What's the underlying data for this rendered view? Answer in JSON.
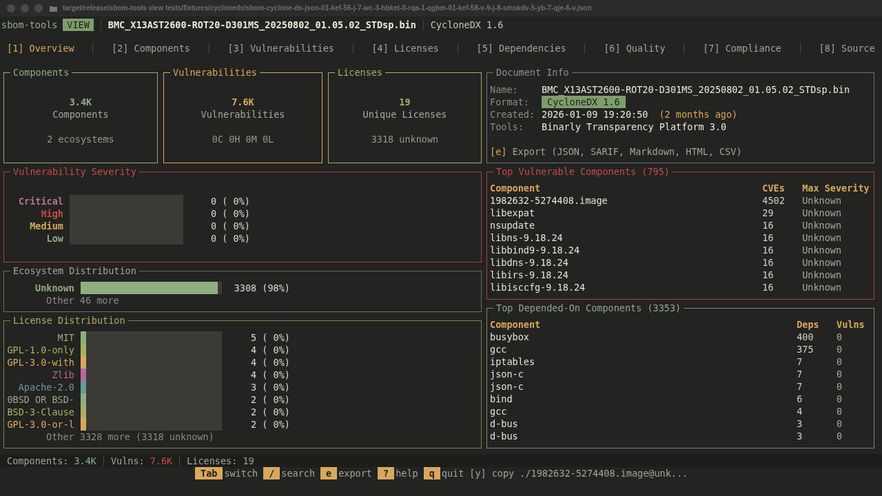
{
  "window": {
    "title": "target/release/sbom-tools view tests/fixtures/cyclonedx/sbom-cyclone-dx-json-01-kef-56-j-7-wc-3-hbket-0-rqa-1-qgbm-01-kef-58-v-9-j-8-smskdv-5-yb-7-qje-6-v.json"
  },
  "header": {
    "app": "sbom-tools",
    "mode": "VIEW",
    "file": "BMC_X13AST2600-ROT20-D301MS_20250802_01.05.02_STDsp.bin",
    "format": "CycloneDX 1.6"
  },
  "tabs": [
    {
      "label": "[1] Overview",
      "selected": true
    },
    {
      "label": "[2] Components",
      "selected": false
    },
    {
      "label": "[3] Vulnerabilities",
      "selected": false
    },
    {
      "label": "[4] Licenses",
      "selected": false
    },
    {
      "label": "[5] Dependencies",
      "selected": false
    },
    {
      "label": "[6] Quality",
      "selected": false
    },
    {
      "label": "[7] Compliance",
      "selected": false
    },
    {
      "label": "[8] Source",
      "selected": false
    }
  ],
  "stat_cards": [
    {
      "title": "Components",
      "value": "3.4K",
      "label": "Components",
      "detail": "2 ecosystems",
      "color": "#8fae80"
    },
    {
      "title": "Vulnerabilities",
      "value": "7.6K",
      "label": "Vulnerabilities",
      "detail": "0C 0H 0M 0L",
      "color": "#d9a85c"
    },
    {
      "title": "Licenses",
      "value": "19",
      "label": "Unique Licenses",
      "detail": "3318 unknown",
      "color": "#a9b064"
    }
  ],
  "severity": {
    "title": "Vulnerability Severity",
    "rows": [
      {
        "label": "Critical",
        "color": "#b87592",
        "reading": "0 ( 0%)"
      },
      {
        "label": "High",
        "color": "#c94a4a",
        "reading": "0 ( 0%)"
      },
      {
        "label": "Medium",
        "color": "#d9a85c",
        "reading": "0 ( 0%)"
      },
      {
        "label": "Low",
        "color": "#8fae80",
        "reading": "0 ( 0%)"
      }
    ]
  },
  "ecosystems": {
    "title": "Ecosystem Distribution",
    "rows": [
      {
        "label": "Unknown",
        "color": "#8fae80",
        "level": 0.97,
        "reading": "3308 (98%)"
      }
    ],
    "more": "Other 46 more"
  },
  "licenses": {
    "title": "License Distribution",
    "rows": [
      {
        "label": "MIT",
        "color": "#8fae80",
        "level": 0.04,
        "reading": "5 ( 0%)"
      },
      {
        "label": "GPL-1.0-only",
        "color": "#a9b064",
        "level": 0.04,
        "reading": "4 ( 0%)"
      },
      {
        "label": "GPL-3.0-with",
        "color": "#d9a85c",
        "level": 0.04,
        "reading": "4 ( 0%)"
      },
      {
        "label": "Zlib",
        "color": "#b8689a",
        "level": 0.04,
        "reading": "4 ( 0%)"
      },
      {
        "label": "Apache-2.0",
        "color": "#6a9a9a",
        "level": 0.04,
        "reading": "3 ( 0%)"
      },
      {
        "label": "0BSD OR BSD-",
        "color": "#8fae80",
        "level": 0.04,
        "reading": "2 ( 0%)"
      },
      {
        "label": "BSD-3-Clause",
        "color": "#a9b064",
        "level": 0.04,
        "reading": "2 ( 0%)"
      },
      {
        "label": "GPL-3.0-or-l",
        "color": "#d9a85c",
        "level": 0.04,
        "reading": "2 ( 0%)"
      }
    ],
    "more": "Other 3328 more (3318 unknown)"
  },
  "document_info": {
    "title": "Document Info",
    "fields": [
      {
        "label": "Name:",
        "value": "BMC_X13AST2600-ROT20-D301MS_20250802_01.05.02_STDsp.bin",
        "kind": "text"
      },
      {
        "label": "Format:",
        "value": "CycloneDX 1.6",
        "kind": "badge"
      },
      {
        "label": "Created:",
        "value": "2026-01-09 19:20:50",
        "note": "(2 months ago)",
        "kind": "text"
      },
      {
        "label": "Tools:",
        "value": "Binarly Transparency Platform 3.0",
        "kind": "text"
      }
    ],
    "export_key": "[e]",
    "export_label": "Export (JSON, SARIF, Markdown, HTML, CSV)"
  },
  "top_vulnerable": {
    "title": "Top Vulnerable Components (795)",
    "columns": [
      "Component",
      "CVEs",
      "Max Severity"
    ],
    "rows": [
      [
        "1982632-5274408.image",
        "4502",
        "Unknown"
      ],
      [
        "libexpat",
        "29",
        "Unknown"
      ],
      [
        "nsupdate",
        "16",
        "Unknown"
      ],
      [
        "libns-9.18.24",
        "16",
        "Unknown"
      ],
      [
        "libbind9-9.18.24",
        "16",
        "Unknown"
      ],
      [
        "libdns-9.18.24",
        "16",
        "Unknown"
      ],
      [
        "libirs-9.18.24",
        "16",
        "Unknown"
      ],
      [
        "libisccfg-9.18.24",
        "16",
        "Unknown"
      ]
    ]
  },
  "top_depended": {
    "title": "Top Depended-On Components (3353)",
    "columns": [
      "Component",
      "Deps",
      "Vulns"
    ],
    "rows": [
      [
        "busybox",
        "400",
        "0"
      ],
      [
        "gcc",
        "375",
        "0"
      ],
      [
        "iptables",
        "7",
        "0"
      ],
      [
        "json-c",
        "7",
        "0"
      ],
      [
        "json-c",
        "7",
        "0"
      ],
      [
        "bind",
        "6",
        "0"
      ],
      [
        "gcc",
        "4",
        "0"
      ],
      [
        "d-bus",
        "3",
        "0"
      ],
      [
        "d-bus",
        "3",
        "0"
      ]
    ]
  },
  "status_bar": [
    {
      "label": "Components:",
      "value": "3.4K",
      "color": "#8fae80"
    },
    {
      "label": "Vulns:",
      "value": "7.6K",
      "color": "#d04a4a"
    },
    {
      "label": "Licenses:",
      "value": "19",
      "color": "#8fae80"
    }
  ],
  "key_hints": [
    {
      "kind": "key",
      "key": "Tab",
      "label": "switch"
    },
    {
      "kind": "key",
      "key": "/",
      "label": "search"
    },
    {
      "kind": "key",
      "key": "e",
      "label": "export"
    },
    {
      "kind": "key",
      "key": "?",
      "label": "help"
    },
    {
      "kind": "key",
      "key": "q",
      "label": "quit"
    },
    {
      "kind": "plain",
      "key": "[y]",
      "label": "copy ./1982632-5274408.image@unk..."
    }
  ]
}
